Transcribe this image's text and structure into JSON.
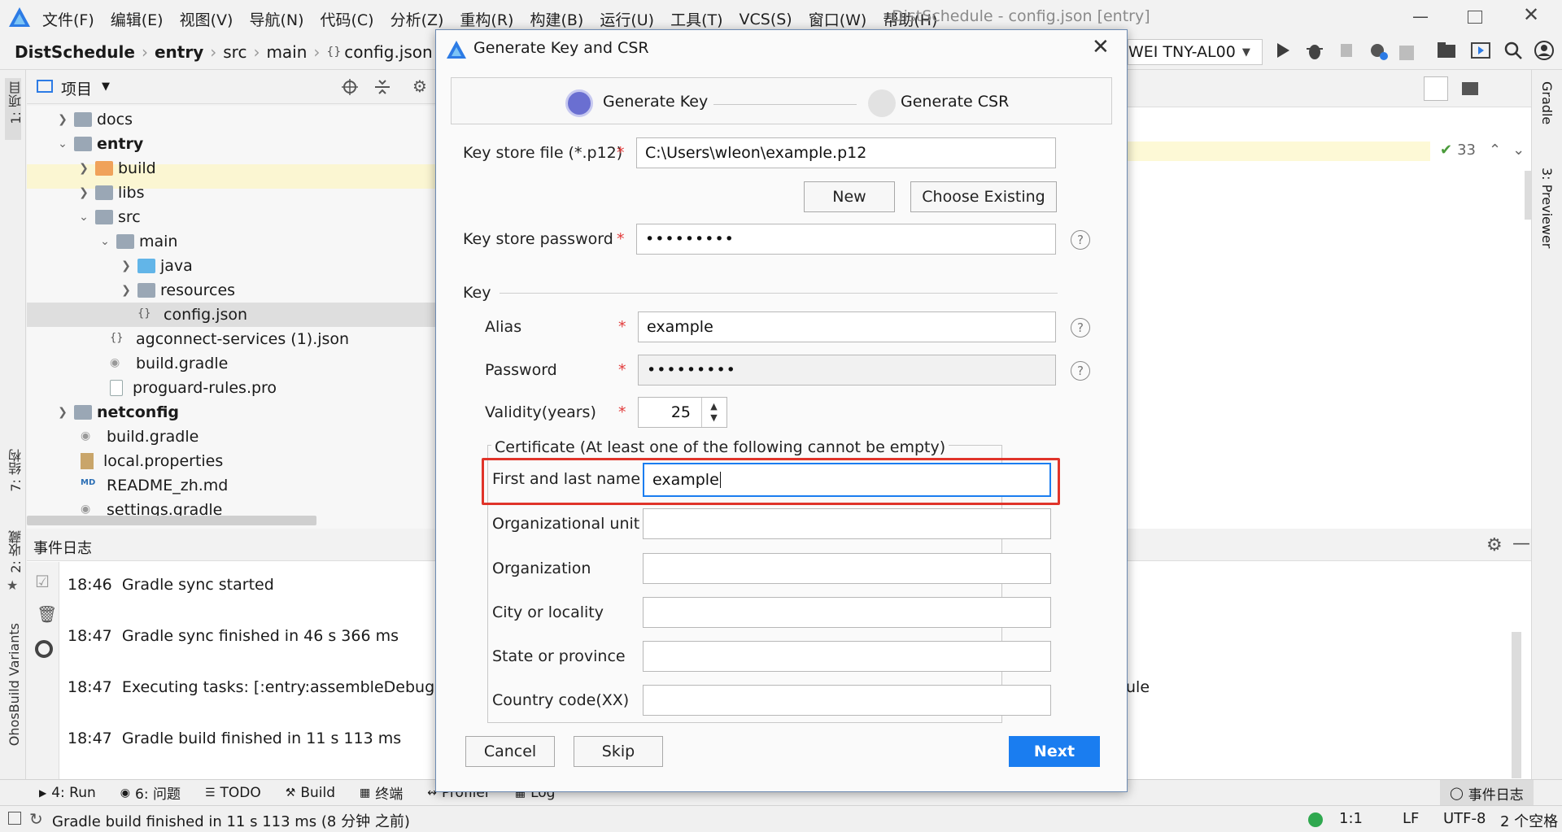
{
  "app": {
    "window_title": "DistSchedule - config.json [entry]",
    "menu": [
      "文件(F)",
      "编辑(E)",
      "视图(V)",
      "导航(N)",
      "代码(C)",
      "分析(Z)",
      "重构(R)",
      "构建(B)",
      "运行(U)",
      "工具(T)",
      "VCS(S)",
      "窗口(W)",
      "帮助(H)"
    ]
  },
  "breadcrumb": [
    "DistSchedule",
    "entry",
    "src",
    "main",
    "config.json"
  ],
  "device_selector": "WEI TNY-AL00",
  "left_stripe": {
    "project": "1: 项目",
    "structure": "7: 结构",
    "favorites": "2: 收藏",
    "build_variants": "OhosBuild Variants"
  },
  "right_stripe": {
    "gradle": "Gradle",
    "previewer": "3: Previewer"
  },
  "project_panel": {
    "title": "项目",
    "tree": [
      {
        "label": "docs",
        "bold": false
      },
      {
        "label": "entry",
        "bold": true
      },
      {
        "label": "build",
        "bold": false
      },
      {
        "label": "libs",
        "bold": false
      },
      {
        "label": "src",
        "bold": false
      },
      {
        "label": "main",
        "bold": false
      },
      {
        "label": "java",
        "bold": false
      },
      {
        "label": "resources",
        "bold": false
      },
      {
        "label": "config.json",
        "bold": false
      },
      {
        "label": "agconnect-services (1).json",
        "bold": false
      },
      {
        "label": "build.gradle",
        "bold": false
      },
      {
        "label": "proguard-rules.pro",
        "bold": false
      },
      {
        "label": "netconfig",
        "bold": true
      },
      {
        "label": "build.gradle",
        "bold": false
      },
      {
        "label": "local.properties",
        "bold": false
      },
      {
        "label": "README_zh.md",
        "bold": false
      },
      {
        "label": "settings.gradle",
        "bold": false
      }
    ]
  },
  "editor": {
    "inspection_count": "33"
  },
  "event_log": {
    "title": "事件日志",
    "lines": [
      {
        "time": "18:46",
        "text": "Gradle sync started"
      },
      {
        "time": "18:47",
        "text": "Gradle sync finished in 46 s 366 ms"
      },
      {
        "time": "18:47",
        "text": "Executing tasks: [:entry:assembleDebug, :netc"
      },
      {
        "time": "18:47",
        "text": "Gradle build finished in 11 s 113 ms"
      }
    ],
    "line3_tail": "ule"
  },
  "bottom_tools": [
    "4: Run",
    "6: 问题",
    "TODO",
    "Build",
    "终端",
    "Profiler",
    "Log"
  ],
  "bottom_right_tool": "事件日志",
  "status": {
    "message": "Gradle build finished in 11 s 113 ms (8 分钟 之前)",
    "position": "1:1",
    "line_sep": "LF",
    "encoding": "UTF-8",
    "indent": "2 个空格"
  },
  "dialog": {
    "title": "Generate Key and CSR",
    "steps": [
      "Generate Key",
      "Generate CSR"
    ],
    "keystore_file_label": "Key store file (*.p12)",
    "keystore_file_value": "C:\\Users\\wleon\\example.p12",
    "new_button": "New",
    "choose_existing_button": "Choose Existing",
    "keystore_password_label": "Key store password",
    "keystore_password_value": "•••••••••",
    "key_section": "Key",
    "alias_label": "Alias",
    "alias_value": "example",
    "password_label": "Password",
    "password_value": "•••••••••",
    "validity_label": "Validity(years)",
    "validity_value": "25",
    "certificate_section": "Certificate (At least one of the following cannot be empty)",
    "first_last_label": "First and last name",
    "first_last_value": "example",
    "org_unit_label": "Organizational unit",
    "org_unit_value": "",
    "org_label": "Organization",
    "org_value": "",
    "city_label": "City or locality",
    "city_value": "",
    "state_label": "State or province",
    "state_value": "",
    "country_label": "Country code(XX)",
    "country_value": "",
    "cancel_button": "Cancel",
    "skip_button": "Skip",
    "next_button": "Next",
    "required_mark": "*",
    "help_mark": "?",
    "accent_color": "#1a7df0",
    "highlight_color": "#e0342a"
  }
}
